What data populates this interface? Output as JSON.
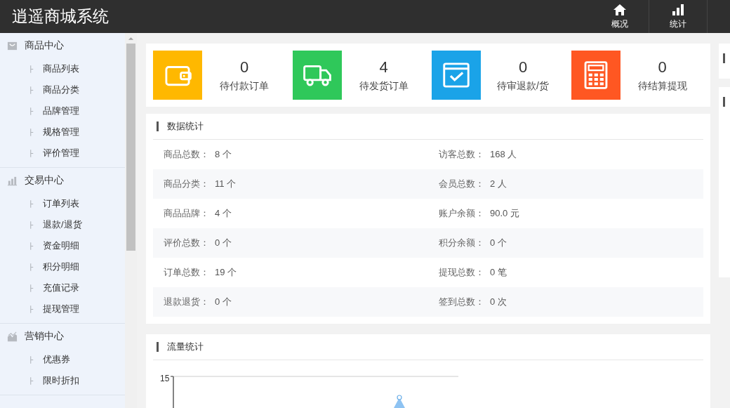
{
  "app_title": "逍遥商城系统",
  "top_nav": [
    {
      "label": "概况"
    },
    {
      "label": "统计"
    }
  ],
  "sidebar": [
    {
      "label": "商品中心",
      "children": [
        {
          "label": "商品列表"
        },
        {
          "label": "商品分类"
        },
        {
          "label": "品牌管理"
        },
        {
          "label": "规格管理"
        },
        {
          "label": "评价管理"
        }
      ]
    },
    {
      "label": "交易中心",
      "children": [
        {
          "label": "订单列表"
        },
        {
          "label": "退款/退货"
        },
        {
          "label": "资金明细"
        },
        {
          "label": "积分明细"
        },
        {
          "label": "充值记录"
        },
        {
          "label": "提现管理"
        }
      ]
    },
    {
      "label": "营销中心",
      "children": [
        {
          "label": "优惠券"
        },
        {
          "label": "限时折扣"
        }
      ]
    }
  ],
  "todo_cards": [
    {
      "color": "#ffb800",
      "count": "0",
      "label": "待付款订单"
    },
    {
      "color": "#2fc85a",
      "count": "4",
      "label": "待发货订单"
    },
    {
      "color": "#1aa3e8",
      "count": "0",
      "label": "待审退款/货"
    },
    {
      "color": "#ff5722",
      "count": "0",
      "label": "待结算提现"
    }
  ],
  "data_stats": {
    "title": "数据统计",
    "rows": [
      {
        "left_label": "商品总数：",
        "left_value": "8 个",
        "right_label": "访客总数：",
        "right_value": "168 人"
      },
      {
        "left_label": "商品分类：",
        "left_value": "11 个",
        "right_label": "会员总数：",
        "right_value": "2 人"
      },
      {
        "left_label": "商品品牌：",
        "left_value": "4 个",
        "right_label": "账户余额：",
        "right_value": "90.0 元"
      },
      {
        "left_label": "评价总数：",
        "left_value": "0 个",
        "right_label": "积分余额：",
        "right_value": "0 个"
      },
      {
        "left_label": "订单总数：",
        "left_value": "19 个",
        "right_label": "提现总数：",
        "right_value": "0 笔"
      },
      {
        "left_label": "退款退货：",
        "left_value": "0 个",
        "right_label": "签到总数：",
        "right_value": "0 次"
      }
    ]
  },
  "traffic": {
    "title": "流量统计",
    "y_tick_labels": [
      "15"
    ]
  }
}
